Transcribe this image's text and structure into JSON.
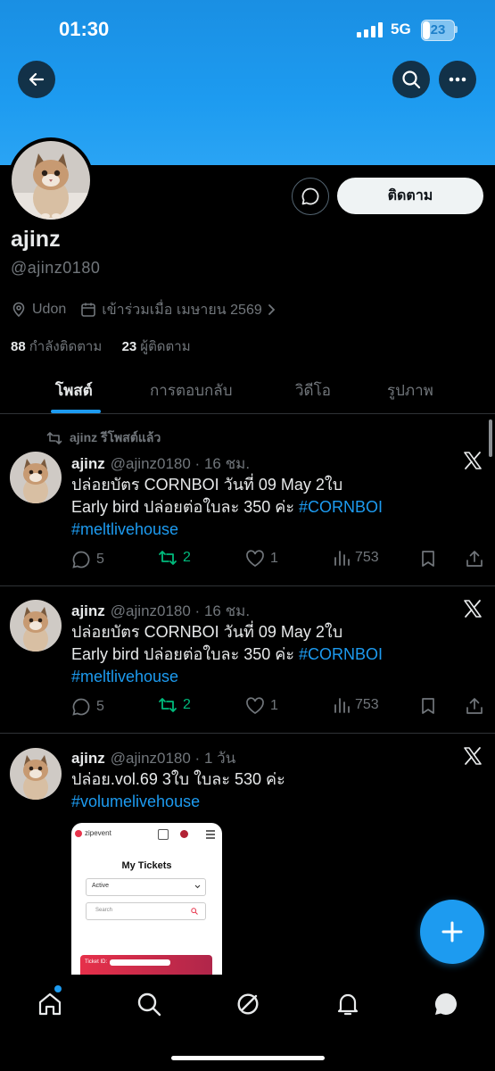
{
  "status_bar": {
    "time": "01:30",
    "network": "5G",
    "battery": "23",
    "battery_level": 0.23
  },
  "profile": {
    "name": "ajinz",
    "handle": "@ajinz0180",
    "location": "Udon",
    "joined": "เข้าร่วมเมื่อ เมษายน 2569",
    "following_count": "88",
    "following_label": "กำลังติดตาม",
    "followers_count": "23",
    "followers_label": "ผู้ติดตาม",
    "follow_button": "ติดตาม"
  },
  "tabs": [
    {
      "label": "โพสต์",
      "active": true
    },
    {
      "label": "การตอบกลับ",
      "active": false
    },
    {
      "label": "วิดีโอ",
      "active": false
    },
    {
      "label": "รูปภาพ",
      "active": false
    }
  ],
  "posts": [
    {
      "repost_label": "ajinz รีโพสต์แล้ว",
      "name": "ajinz",
      "meta": "@ajinz0180 · 16 ชม.",
      "line1": "ปล่อยบัตร CORNBOI วันที่ 09 May 2ใบ",
      "line2_text": "Early bird ปล่อยต่อใบละ 350 ค่ะ ",
      "line2_tag": "#CORNBOI",
      "line3_tag": "#meltlivehouse",
      "replies": "5",
      "reposts": "2",
      "likes": "1",
      "views": "753"
    },
    {
      "name": "ajinz",
      "meta": "@ajinz0180 · 16 ชม.",
      "line1": "ปล่อยบัตร CORNBOI วันที่ 09 May 2ใบ",
      "line2_text": "Early bird ปล่อยต่อใบละ 350 ค่ะ ",
      "line2_tag": "#CORNBOI",
      "line3_tag": "#meltlivehouse",
      "replies": "5",
      "reposts": "2",
      "likes": "1",
      "views": "753"
    },
    {
      "name": "ajinz",
      "meta": "@ajinz0180 · 1 วัน",
      "line1": "ปล่อย.vol.69 3ใบ ใบละ 530 ค่ะ",
      "line2_tag": "#volumelivehouse"
    }
  ],
  "attachment": {
    "brand": "zipevent",
    "title": "My Tickets",
    "dropdown_value": "Active",
    "search_placeholder": "Search",
    "ticket_label": "Ticket ID:"
  },
  "colors": {
    "accent": "#1d9bf0",
    "repost_green": "#00ba7c",
    "muted": "#71767b",
    "background": "#000000"
  }
}
